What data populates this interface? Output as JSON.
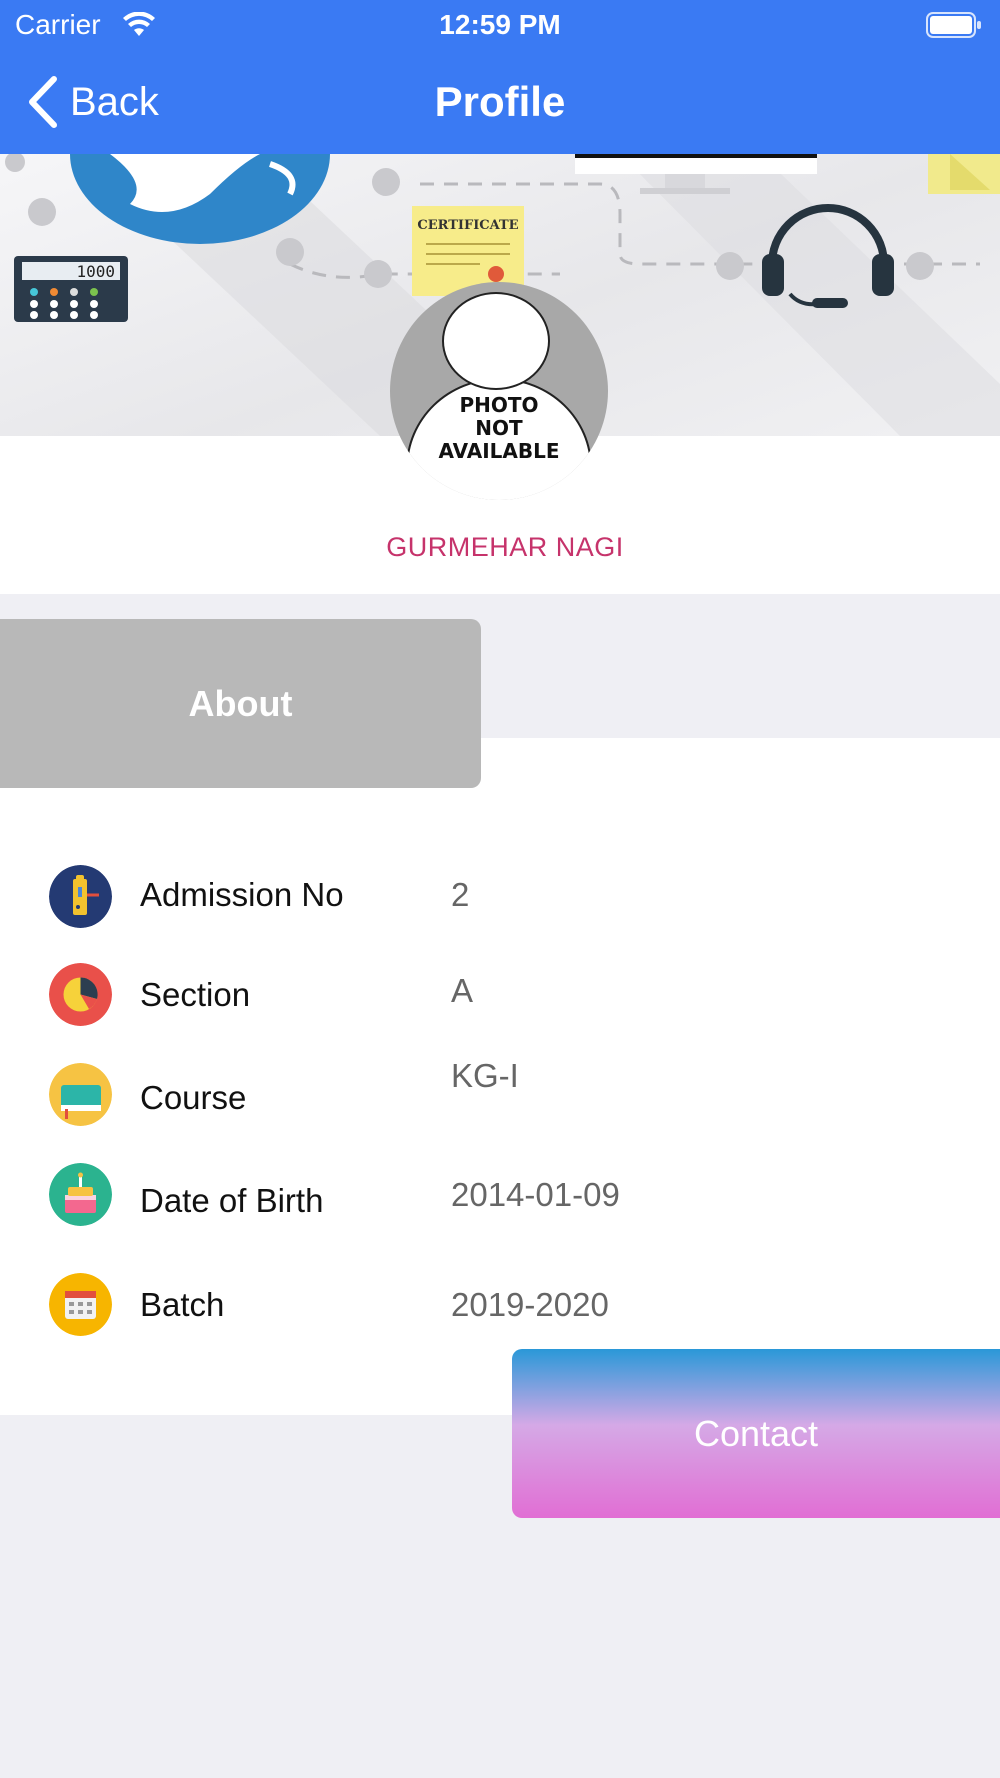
{
  "status_bar": {
    "carrier": "Carrier",
    "time": "12:59 PM"
  },
  "nav": {
    "back_label": "Back",
    "title": "Profile"
  },
  "banner": {
    "calculator_display": "1000",
    "certificate_text": "CERTIFICATE"
  },
  "profile": {
    "photo_placeholder": [
      "PHOTO",
      "NOT",
      "AVAILABLE"
    ],
    "name": "GURMEHAR NAGI"
  },
  "tabs": {
    "about_label": "About"
  },
  "details": [
    {
      "label": "Admission No",
      "value": "2",
      "icon": "id-card-icon"
    },
    {
      "label": "Section",
      "value": "A",
      "icon": "pie-chart-icon"
    },
    {
      "label": "Course",
      "value": "KG-I",
      "icon": "book-icon"
    },
    {
      "label": "Date of Birth",
      "value": "2014-01-09",
      "icon": "birthday-cake-icon"
    },
    {
      "label": "Batch",
      "value": "2019-2020",
      "icon": "calendar-icon"
    }
  ],
  "contact_button": {
    "label": "Contact"
  },
  "colors": {
    "nav_blue": "#3a7af3",
    "name_color": "#c6336b",
    "about_tab_gray": "#b8b8b8",
    "background": "#efeff4"
  }
}
